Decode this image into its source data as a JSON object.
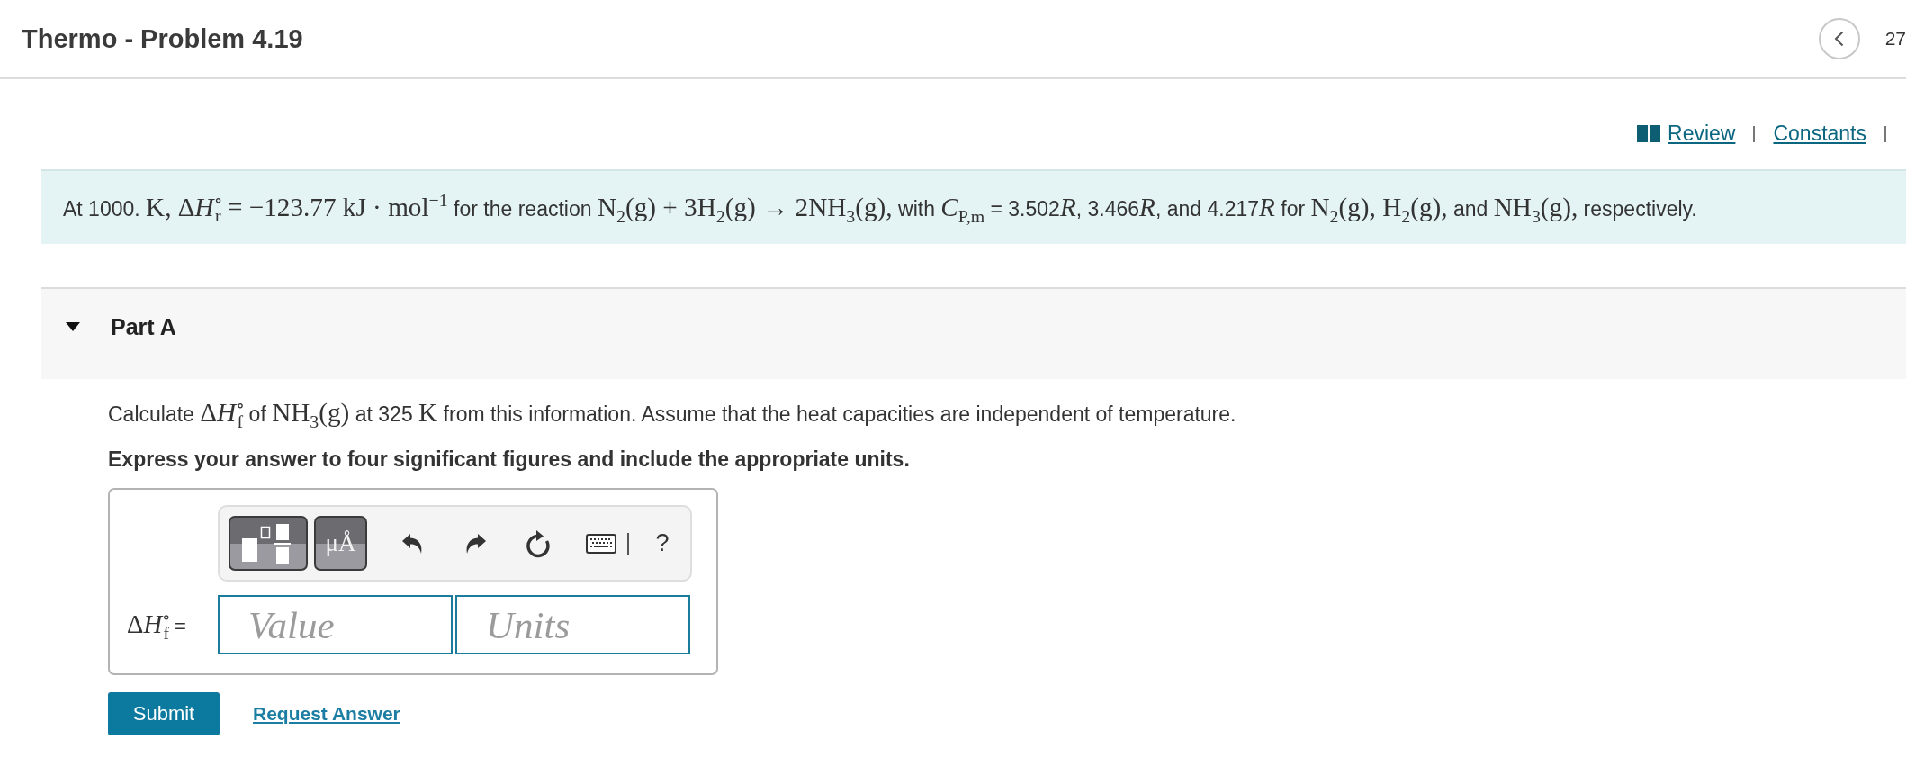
{
  "header": {
    "title": "Thermo - Problem 4.19",
    "page_number": "27"
  },
  "resources": {
    "links": [
      {
        "kind": "icon_link",
        "label": "Review"
      },
      {
        "kind": "text_link",
        "label": "Constants"
      }
    ]
  },
  "statement": [
    {
      "kind": "text",
      "text": "At 1000. "
    },
    {
      "kind": "math",
      "text": "K, Δ"
    },
    {
      "kind": "math",
      "text": "*H*$^{∘}$$_{r}$ = −123.77 kJ · mol$^{−1}$"
    },
    {
      "kind": "text",
      "text": " for the reaction "
    },
    {
      "kind": "math",
      "text": "N$_{2}$(g) + 3H$_{2}$(g) → 2NH$_{3}$(g),"
    },
    {
      "kind": "text",
      "text": " with "
    },
    {
      "kind": "math",
      "text": "*C*$_{P,m}$"
    },
    {
      "kind": "text",
      "text": " = 3.502"
    },
    {
      "kind": "math",
      "text": "*R*"
    },
    {
      "kind": "text",
      "text": ", 3.466"
    },
    {
      "kind": "math",
      "text": "*R*"
    },
    {
      "kind": "text",
      "text": ", and 4.217"
    },
    {
      "kind": "math",
      "text": "*R*"
    },
    {
      "kind": "text",
      "text": " for "
    },
    {
      "kind": "math",
      "text": "N$_{2}$(g), H$_{2}$(g),"
    },
    {
      "kind": "text",
      "text": " and "
    },
    {
      "kind": "math",
      "text": "NH$_{3}$(g),"
    },
    {
      "kind": "text",
      "text": " respectively."
    }
  ],
  "part": {
    "title": "Part A",
    "expanded": true,
    "question": [
      {
        "kind": "text",
        "text": "Calculate "
      },
      {
        "kind": "math",
        "text": "Δ"
      },
      {
        "kind": "math",
        "text": "*H*$^{∘}$$_{f}$"
      },
      {
        "kind": "text",
        "text": " of "
      },
      {
        "kind": "math",
        "text": "NH$_{3}$(g)"
      },
      {
        "kind": "text",
        "text": " at 325 "
      },
      {
        "kind": "math",
        "text": "K"
      },
      {
        "kind": "text",
        "text": " from this information. Assume that the heat capacities are independent of temperature."
      }
    ],
    "instruction": "Express your answer to four significant figures and include the appropriate units.",
    "answer": {
      "label": [
        {
          "kind": "math",
          "text": "Δ"
        },
        {
          "kind": "math",
          "text": "*H*$^{∘}$$_{f}$"
        },
        {
          "kind": "text",
          "text": " ="
        }
      ],
      "toolbar": {
        "units_button": "μÅ",
        "help_button": "?"
      },
      "value_field": {
        "placeholder": "Value"
      },
      "units_field": {
        "placeholder": "Units"
      }
    },
    "submit_button": "Submit",
    "request_answer_link": "Request Answer"
  }
}
